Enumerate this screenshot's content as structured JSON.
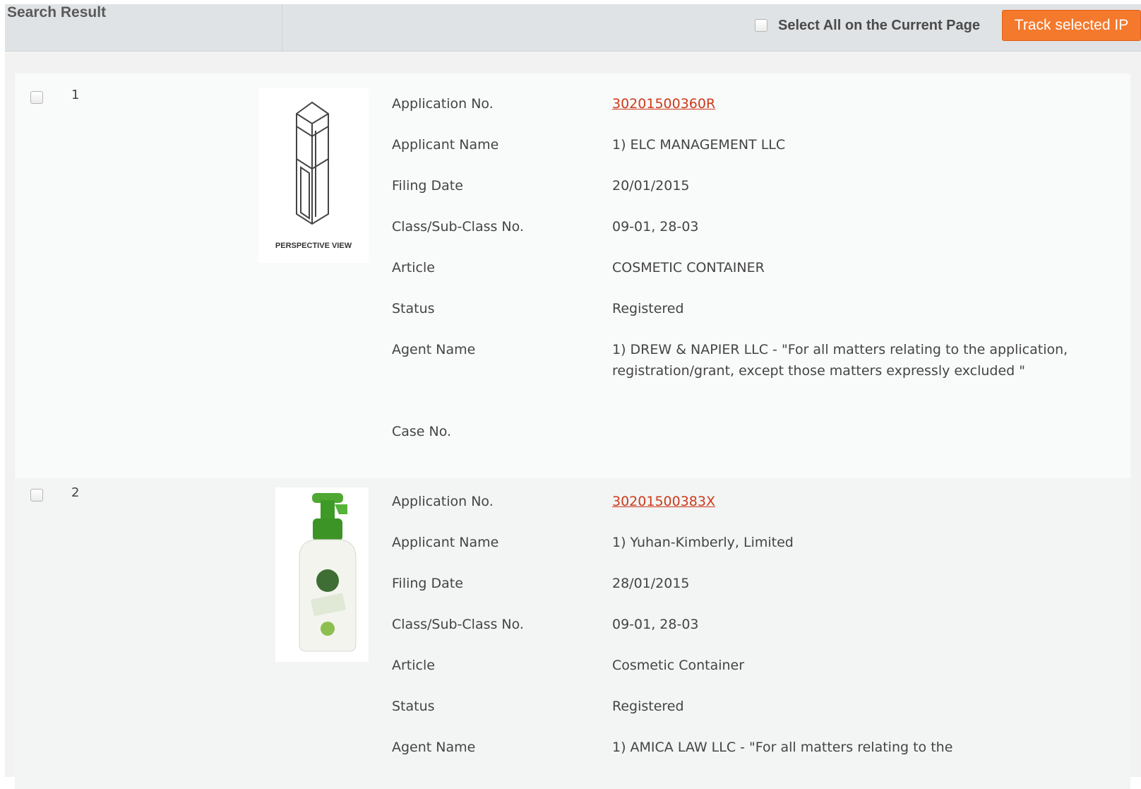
{
  "header": {
    "title": "Search Result",
    "select_all_label": "Select All on the Current Page",
    "track_button": "Track selected IP"
  },
  "labels": {
    "application_no": "Application No.",
    "applicant_name": "Applicant Name",
    "filing_date": "Filing Date",
    "class_no": "Class/Sub-Class No.",
    "article": "Article",
    "status": "Status",
    "agent_name": "Agent Name",
    "case_no": "Case No."
  },
  "results": [
    {
      "index": "1",
      "image_caption": "PERSPECTIVE VIEW",
      "application_no": "30201500360R",
      "applicant_name": "1) ELC MANAGEMENT LLC",
      "filing_date": "20/01/2015",
      "class_no": "09-01, 28-03",
      "article": "COSMETIC CONTAINER",
      "status": "Registered",
      "agent_name": "1) DREW & NAPIER LLC - \"For all matters relating to the application, registration/grant, except those matters expressly excluded \"",
      "case_no": ""
    },
    {
      "index": "2",
      "image_caption": "",
      "application_no": "30201500383X",
      "applicant_name": "1) Yuhan-Kimberly, Limited",
      "filing_date": "28/01/2015",
      "class_no": "09-01, 28-03",
      "article": "Cosmetic Container",
      "status": "Registered",
      "agent_name": "1) AMICA LAW LLC - \"For all matters relating to the"
    }
  ],
  "colors": {
    "accent_button": "#f4792c",
    "link": "#cc3a1b",
    "header_bg": "#e0e3e5"
  }
}
